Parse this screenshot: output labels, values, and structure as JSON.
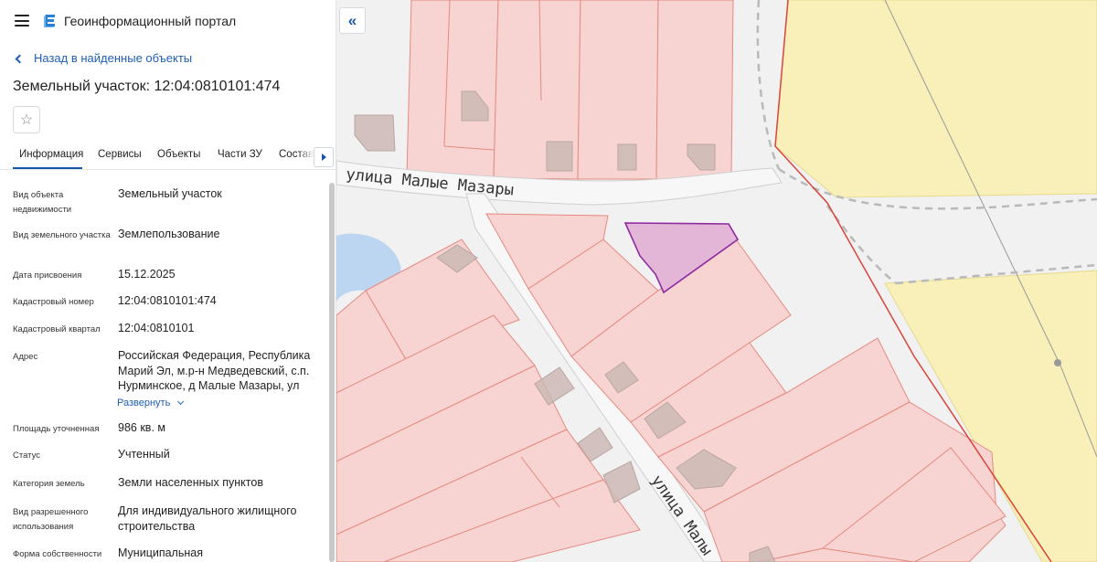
{
  "header": {
    "menu_icon": "hamburger-icon",
    "logo_icon": "portal-logo-icon",
    "title": "Геоинформационный портал"
  },
  "nav": {
    "back_label": "Назад в найденные объекты"
  },
  "object": {
    "title": "Земельный участок: 12:04:0810101:474",
    "favorite_icon": "star-icon"
  },
  "tabs": [
    {
      "label": "Информация",
      "active": true
    },
    {
      "label": "Сервисы",
      "active": false
    },
    {
      "label": "Объекты",
      "active": false
    },
    {
      "label": "Части ЗУ",
      "active": false
    },
    {
      "label": "Состав",
      "active": false
    }
  ],
  "properties": [
    {
      "key": "Вид объекта недвижимости",
      "value": "Земельный участок"
    },
    {
      "key": "Вид земельного участка",
      "value": "Землепользование"
    },
    {
      "key": "Дата присвоения",
      "value": "15.12.2025"
    },
    {
      "key": "Кадастровый номер",
      "value": "12:04:0810101:474"
    },
    {
      "key": "Кадастровый квартал",
      "value": "12:04:0810101"
    },
    {
      "key": "Адрес",
      "value": "Российская Федерация, Республика Марий Эл, м.р-н Медведевский, с.п. Нурминское, д Малые Мазары, ул"
    },
    {
      "key": "Площадь уточненная",
      "value": "986 кв. м"
    },
    {
      "key": "Статус",
      "value": "Учтенный"
    },
    {
      "key": "Категория земель",
      "value": "Земли населенных пунктов"
    },
    {
      "key": "Вид разрешенного использования",
      "value": "Для индивидуального жилищного строительства"
    },
    {
      "key": "Форма собственности",
      "value": "Муниципальная"
    }
  ],
  "address_expand_label": "Развернуть",
  "map": {
    "collapse_label": "«",
    "street_top": "улица Малые Мазары",
    "street_diag": "улица Малы",
    "colors": {
      "parcel_fill": "#f7d3d1",
      "parcel_stroke": "#e58a80",
      "selected_fill": "#e3b6d8",
      "selected_stroke": "#8e2aa0",
      "agri_fill": "#f8efb9",
      "road": "#f7f7f7",
      "building": "#cdb9b5",
      "water": "#bcd6f2",
      "border_red": "#d8453a"
    }
  }
}
